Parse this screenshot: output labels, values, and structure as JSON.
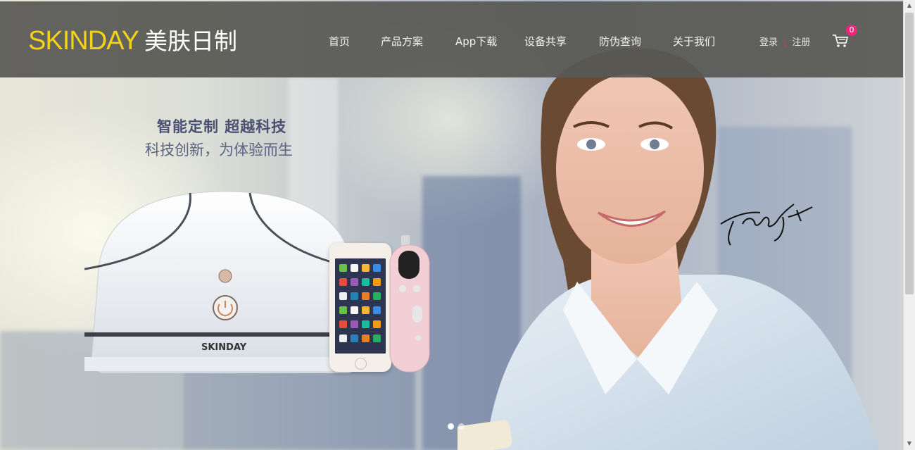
{
  "brand": {
    "name_en": "SKINDAY",
    "name_cn": "美肤日制",
    "accent": "#f3d21a"
  },
  "nav": {
    "items": [
      {
        "label": "首页"
      },
      {
        "label": "产品方案"
      },
      {
        "label": "App下载"
      },
      {
        "label": "设备共享"
      },
      {
        "label": "防伪查询"
      },
      {
        "label": "关于我们"
      }
    ]
  },
  "auth": {
    "login": "登录",
    "separator": "|",
    "register": "注册"
  },
  "cart": {
    "icon": "cart-icon",
    "count": "0",
    "badge_color": "#e8287a"
  },
  "hero": {
    "headline": "智能定制  超越科技",
    "subline": "科技创新，为体验而生",
    "device_label": "SKINDAY",
    "slides": {
      "total": 2,
      "active": 1
    }
  }
}
